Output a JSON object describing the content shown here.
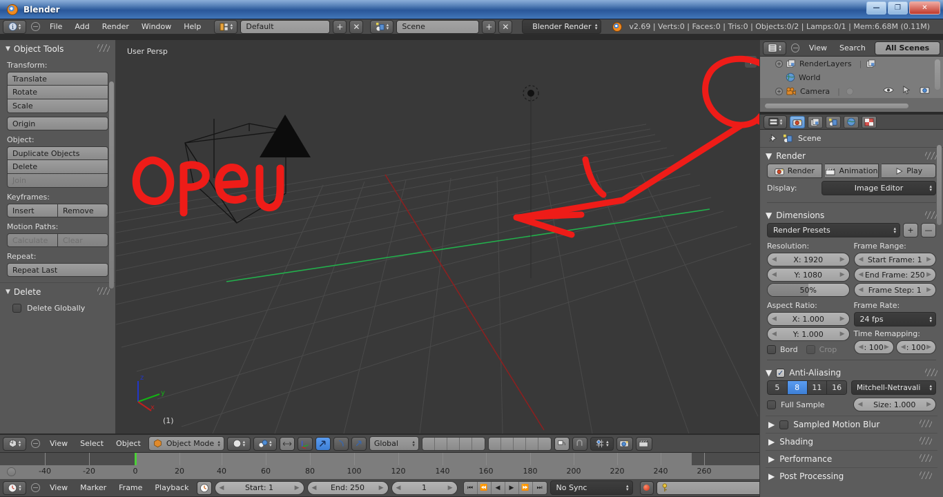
{
  "window": {
    "title": "Blender",
    "buttons": {
      "minimize": "—",
      "maximize": "❐",
      "close": "✕"
    }
  },
  "top_header": {
    "menus": [
      "File",
      "Add",
      "Render",
      "Window",
      "Help"
    ],
    "screen_layout": "Default",
    "scene_name": "Scene",
    "render_engine": "Blender Render",
    "stats": "v2.69 | Verts:0 | Faces:0 | Tris:0 | Objects:0/2 | Lamps:0/1 | Mem:6.68M (0.11M)",
    "add_label": "+",
    "remove_label": "✕"
  },
  "tool_shelf": {
    "panel_title": "Object Tools",
    "transform_label": "Transform:",
    "transform_buttons": [
      "Translate",
      "Rotate",
      "Scale"
    ],
    "origin_button": "Origin",
    "object_label": "Object:",
    "object_buttons": [
      "Duplicate Objects",
      "Delete",
      "Join"
    ],
    "keyframes_label": "Keyframes:",
    "keyframe_buttons": [
      "Insert",
      "Remove"
    ],
    "motion_paths_label": "Motion Paths:",
    "motion_path_buttons": [
      "Calculate",
      "Clear"
    ],
    "repeat_label": "Repeat:",
    "repeat_button": "Repeat Last",
    "delete_panel_title": "Delete",
    "delete_globally_label": "Delete Globally"
  },
  "viewport": {
    "view_label": "User Persp",
    "object_count": "(1)",
    "plus_button": "+",
    "axis_x": "x",
    "axis_y": "y",
    "axis_z": "z",
    "annotation_text": "open",
    "annotation_color": "#ee1c18"
  },
  "viewport_header": {
    "menus": [
      "View",
      "Select",
      "Object"
    ],
    "mode": "Object Mode",
    "transform_orientation": "Global"
  },
  "timeline_strip": {
    "tick_labels": [
      "-40",
      "-20",
      "0",
      "20",
      "40",
      "60",
      "80",
      "100",
      "120",
      "140",
      "160",
      "180",
      "200",
      "220",
      "240",
      "260"
    ],
    "playhead_frame": "0"
  },
  "timeline_header": {
    "menus": [
      "View",
      "Marker",
      "Frame",
      "Playback"
    ],
    "start_label": "Start: 1",
    "end_label": "End: 250",
    "current_frame": "1",
    "sync_mode": "No Sync"
  },
  "outliner": {
    "menus": [
      "View",
      "Search"
    ],
    "display_mode": "All Scenes",
    "rows": [
      {
        "label": "RenderLayers",
        "icon": "renderlayers-icon"
      },
      {
        "label": "World",
        "icon": "world-icon"
      },
      {
        "label": "Camera",
        "icon": "camera-icon"
      }
    ]
  },
  "properties": {
    "breadcrumb": "Scene",
    "tabs": [
      "render-tab",
      "renderlayers-tab",
      "scene-tab",
      "world-tab",
      "texture-tab"
    ],
    "render_panel": {
      "title": "Render",
      "render_button": "Render",
      "animation_button": "Animation",
      "play_button": "Play",
      "display_label": "Display:",
      "display_value": "Image Editor"
    },
    "dimensions_panel": {
      "title": "Dimensions",
      "preset": "Render Presets",
      "add_preset": "+",
      "remove_preset": "—",
      "resolution_label": "Resolution:",
      "res_x": "X: 1920",
      "res_y": "Y: 1080",
      "res_percent": "50%",
      "frame_range_label": "Frame Range:",
      "start_frame": "Start Frame: 1",
      "end_frame": "End Frame: 250",
      "frame_step": "Frame Step: 1",
      "aspect_label": "Aspect Ratio:",
      "aspect_x": "X: 1.000",
      "aspect_y": "Y: 1.000",
      "frame_rate_label": "Frame Rate:",
      "frame_rate": "24 fps",
      "time_remap_label": "Time Remapping:",
      "remap_old": ": 100",
      "remap_new": ": 100",
      "border_label": "Bord",
      "crop_label": "Crop"
    },
    "antialiasing_panel": {
      "title": "Anti-Aliasing",
      "samples": [
        "5",
        "8",
        "11",
        "16"
      ],
      "active_sample": "8",
      "filter": "Mitchell-Netravali",
      "full_sample_label": "Full Sample",
      "size_label": "Size: 1.000"
    },
    "collapsed_panels": [
      "Sampled Motion Blur",
      "Shading",
      "Performance",
      "Post Processing"
    ]
  }
}
